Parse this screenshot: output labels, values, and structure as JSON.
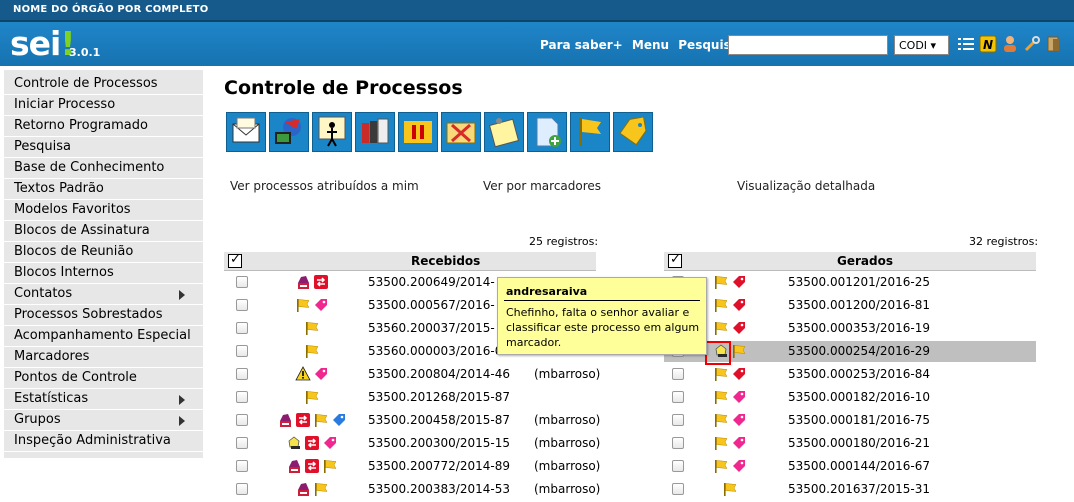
{
  "org": "NOME DO ÓRGÃO POR COMPLETO",
  "logo": "sei",
  "version": "3.0.1",
  "header_links": [
    "Para saber+",
    "Menu",
    "Pesquisa"
  ],
  "search": {
    "value": "",
    "placeholder": ""
  },
  "unit_select": "CODI ▾",
  "sidebar": {
    "items": [
      {
        "label": "Controle de Processos",
        "arrow": false
      },
      {
        "label": "Iniciar Processo",
        "arrow": false
      },
      {
        "label": "Retorno Programado",
        "arrow": false
      },
      {
        "label": "Pesquisa",
        "arrow": false
      },
      {
        "label": "Base de Conhecimento",
        "arrow": false
      },
      {
        "label": "Textos Padrão",
        "arrow": false
      },
      {
        "label": "Modelos Favoritos",
        "arrow": false
      },
      {
        "label": "Blocos de Assinatura",
        "arrow": false
      },
      {
        "label": "Blocos de Reunião",
        "arrow": false
      },
      {
        "label": "Blocos Internos",
        "arrow": false
      },
      {
        "label": "Contatos",
        "arrow": true
      },
      {
        "label": "Processos Sobrestados",
        "arrow": false
      },
      {
        "label": "Acompanhamento Especial",
        "arrow": false
      },
      {
        "label": "Marcadores",
        "arrow": false
      },
      {
        "label": "Pontos de Controle",
        "arrow": false
      },
      {
        "label": "Estatísticas",
        "arrow": true
      },
      {
        "label": "Grupos",
        "arrow": true
      },
      {
        "label": "Inspeção Administrativa",
        "arrow": false
      }
    ]
  },
  "main": {
    "title": "Controle de Processos",
    "links": [
      "Ver processos atribuídos a mim",
      "Ver por marcadores",
      "Visualização detalhada"
    ],
    "received": {
      "count": "25 registros:",
      "title": "Recebidos",
      "rows": [
        {
          "proc": "53500.200649/2014-",
          "user": "",
          "icons": [
            "stamp",
            "redarrow"
          ]
        },
        {
          "proc": "53500.000567/2016-",
          "user": "",
          "icons": [
            "flag",
            "pinktag"
          ]
        },
        {
          "proc": "53560.200037/2015-",
          "user": "",
          "icons": [
            "flag"
          ]
        },
        {
          "proc": "53560.000003/2016-00",
          "user": "",
          "icons": [
            "flag"
          ]
        },
        {
          "proc": "53500.200804/2014-46",
          "user": "(mbarroso)",
          "icons": [
            "warning",
            "pinktag"
          ]
        },
        {
          "proc": "53500.201268/2015-87",
          "user": "",
          "icons": [
            "flag"
          ]
        },
        {
          "proc": "53500.200458/2015-87",
          "user": "(mbarroso)",
          "icons": [
            "stamp",
            "redarrow",
            "flag",
            "bluetag"
          ]
        },
        {
          "proc": "53500.200300/2015-15",
          "user": "(mbarroso)",
          "icons": [
            "bell",
            "redarrow",
            "pinktag"
          ]
        },
        {
          "proc": "53500.200772/2014-89",
          "user": "(mbarroso)",
          "icons": [
            "stamp",
            "redarrow",
            "flag"
          ]
        },
        {
          "proc": "53500.200383/2014-53",
          "user": "(mbarroso)",
          "icons": [
            "stamp",
            "flag"
          ]
        }
      ]
    },
    "generated": {
      "count": "32 registros:",
      "title": "Gerados",
      "rows": [
        {
          "proc": "53500.001201/2016-25",
          "icons": [
            "flag",
            "redtag"
          ]
        },
        {
          "proc": "53500.001200/2016-81",
          "icons": [
            "flag",
            "redtag"
          ]
        },
        {
          "proc": "53500.000353/2016-19",
          "icons": [
            "flag",
            "redtag"
          ]
        },
        {
          "proc": "53500.000254/2016-29",
          "icons": [
            "bell",
            "flag"
          ]
        },
        {
          "proc": "53500.000253/2016-84",
          "icons": [
            "flag",
            "redtag"
          ]
        },
        {
          "proc": "53500.000182/2016-10",
          "icons": [
            "flag",
            "pinktag"
          ]
        },
        {
          "proc": "53500.000181/2016-75",
          "icons": [
            "flag",
            "pinktag"
          ]
        },
        {
          "proc": "53500.000180/2016-21",
          "icons": [
            "flag",
            "pinktag"
          ]
        },
        {
          "proc": "53500.000144/2016-67",
          "icons": [
            "flag",
            "pinktag"
          ]
        },
        {
          "proc": "53500.201637/2015-31",
          "icons": [
            "flag"
          ]
        }
      ]
    },
    "tooltip": {
      "user": "andresaraiva",
      "message": "Chefinho, falta o senhor avaliar e classificar este processo em algum marcador."
    }
  }
}
